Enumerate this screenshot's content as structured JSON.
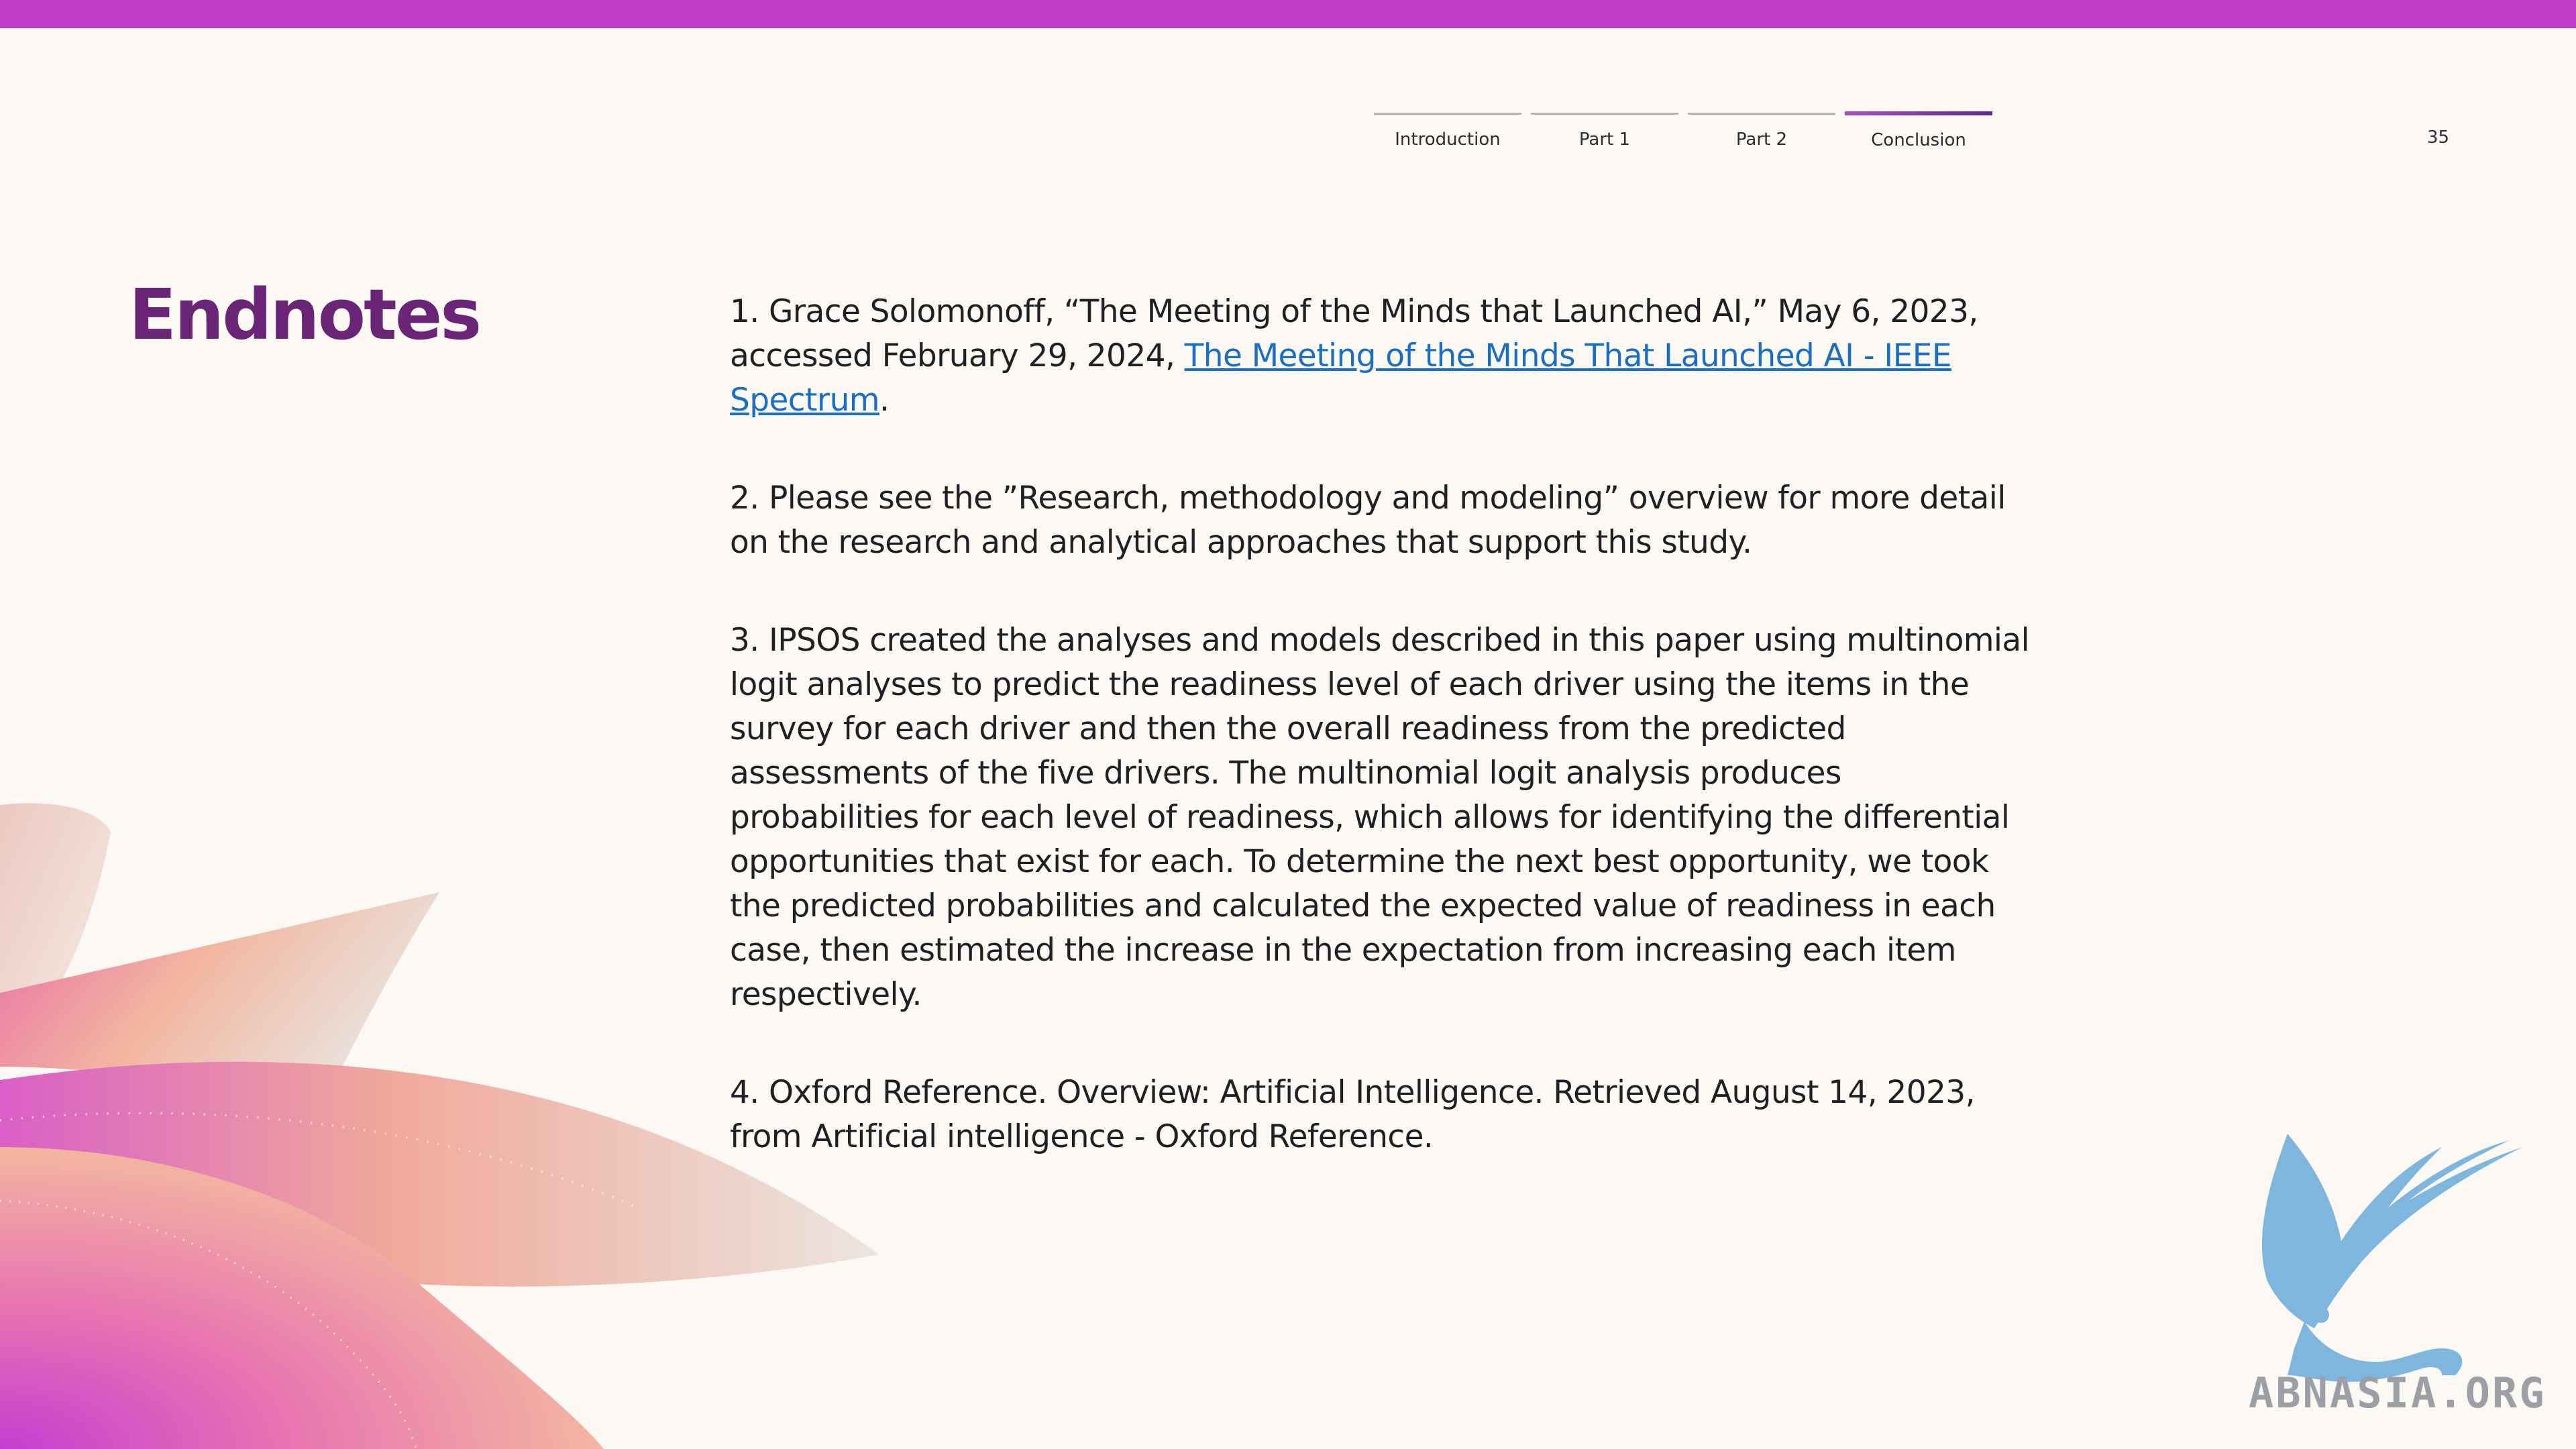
{
  "nav": {
    "tabs": [
      {
        "label": "Introduction",
        "active": false
      },
      {
        "label": "Part 1",
        "active": false
      },
      {
        "label": "Part 2",
        "active": false
      },
      {
        "label": "Conclusion",
        "active": true
      }
    ]
  },
  "page_number": "35",
  "title": "Endnotes",
  "endnotes": [
    {
      "text": "1. Grace Solomonoff, “The Meeting of the Minds that Launched AI,” May 6, 2023, accessed February 29, 2024, ",
      "link": "The Meeting of the Minds That Launched AI - IEEE Spectrum",
      "after": "."
    },
    {
      "text": "2. Please see the ”Research, methodology and modeling” overview for more detail on the research and analytical approaches that support this study."
    },
    {
      "text": "3. IPSOS created the analyses and models described in this paper using multinomial logit analyses to predict the readiness level of each driver using the items in the survey for each driver and then the overall readiness from the predicted assessments of the five drivers. The multinomial logit analysis produces probabilities for each level of readiness, which allows for identifying the differential opportunities that exist for each. To determine the next best opportunity, we took the predicted probabilities and calculated the expected value of readiness in each case, then estimated the increase in the expectation from increasing each item respectively."
    },
    {
      "text": "4. Oxford Reference. Overview: Artificial Intelligence. Retrieved August 14, 2023, from Artificial intelligence - Oxford Reference."
    }
  ],
  "watermark": "ABNASIA.ORG",
  "colors": {
    "accent_bar": "#bf3bc8",
    "title": "#6b2577",
    "link": "#1a6fc4",
    "background": "#fcf8f4"
  }
}
